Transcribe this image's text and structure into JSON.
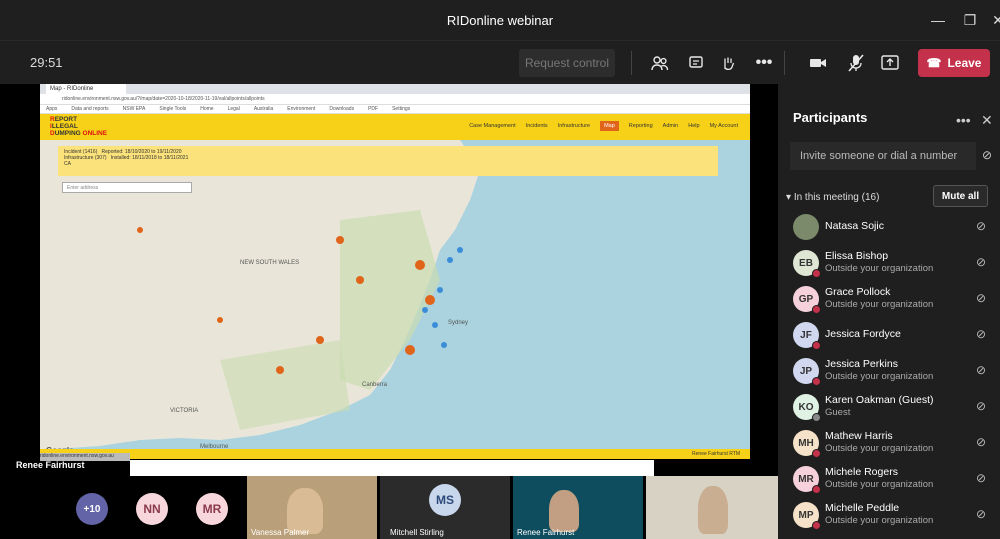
{
  "window": {
    "title": "RIDonline webinar",
    "min": "—",
    "max": "❐",
    "close": "✕"
  },
  "toolbar": {
    "timer": "29:51",
    "request_control": "Request control",
    "leave_label": "Leave",
    "icons": [
      "people-icon",
      "chat-icon",
      "raise-hand-icon",
      "more-icon",
      "camera-icon",
      "mic-off-icon",
      "share-icon"
    ]
  },
  "shared_screen": {
    "browser_tab": "Map - RIDonline",
    "url": "ridonline.environment.nsw.gov.au/?/map/date=2020-10-18/2020-11-19/val/allpoints/allpoints",
    "bookmarks": [
      "Apps",
      "Data and reports",
      "NSW EPA",
      "Single Tools",
      "Home",
      "Legal",
      "Australia",
      "Environment",
      "Downloads",
      "PDF",
      "Settings"
    ],
    "logo_lines": [
      "EPORT",
      "LLEGAL",
      "UMPING"
    ],
    "logo_letters": [
      "R",
      "I",
      "D"
    ],
    "logo_online": "ONLINE",
    "nav": [
      "Case Management",
      "Incidents",
      "Infrastructure",
      "Map",
      "Reporting",
      "Admin",
      "Help",
      "My Account"
    ],
    "active_nav": "Map",
    "filters": [
      "Incident (1416)",
      "Infrastructure (307)",
      "CA"
    ],
    "date_filters": [
      "Reported: 18/10/2020 to 19/11/2020",
      "Installed: 18/11/2018 to 18/11/2021"
    ],
    "search_placeholder": "Enter address",
    "map_labels": [
      "NEW SOUTH WALES",
      "VICTORIA",
      "Melbourne",
      "Canberra",
      "Sydney"
    ],
    "google": "Google",
    "footer_right": "Renee Fairhurst  RTM",
    "status_url": "ridonline.environment.nsw.gov.au"
  },
  "presenter_label": "Renee Fairhurst",
  "gallery": [
    {
      "type": "avatar",
      "text": "+10",
      "color": "#6264a7"
    },
    {
      "type": "avatar",
      "text": "NN",
      "color": "#f8d7dc"
    },
    {
      "type": "avatar",
      "text": "MR",
      "color": "#f8d7dc"
    },
    {
      "type": "video",
      "label": "Vanessa Palmer"
    },
    {
      "type": "avatar-tile",
      "text": "MS",
      "label": "Mitchell Stirling",
      "color": "#c9d7ec"
    },
    {
      "type": "video",
      "label": "Renee Fairhurst"
    },
    {
      "type": "video",
      "label": ""
    }
  ],
  "panel": {
    "title": "Participants",
    "invite_placeholder": "Invite someone or dial a number",
    "meeting_header": "In this meeting (16)",
    "mute_all": "Mute all",
    "participants": [
      {
        "initials": "",
        "name": "Natasa Sojic",
        "sub": "",
        "color": "#7a8a6a",
        "photo": true,
        "dot": ""
      },
      {
        "initials": "EB",
        "name": "Elissa Bishop",
        "sub": "Outside your organization",
        "color": "#dfe6d4",
        "dot": "#c4314b"
      },
      {
        "initials": "GP",
        "name": "Grace Pollock",
        "sub": "Outside your organization",
        "color": "#f6d1dc",
        "dot": "#c4314b"
      },
      {
        "initials": "JF",
        "name": "Jessica Fordyce",
        "sub": "",
        "color": "#d0d7ef",
        "dot": "#c4314b"
      },
      {
        "initials": "JP",
        "name": "Jessica Perkins",
        "sub": "Outside your organization",
        "color": "#d0d7ef",
        "dot": "#c4314b"
      },
      {
        "initials": "KO",
        "name": "Karen Oakman (Guest)",
        "sub": "Guest",
        "color": "#dff2e4",
        "dot": "#888"
      },
      {
        "initials": "MH",
        "name": "Mathew Harris",
        "sub": "Outside your organization",
        "color": "#f6e2c8",
        "dot": "#c4314b"
      },
      {
        "initials": "MR",
        "name": "Michele Rogers",
        "sub": "Outside your organization",
        "color": "#f6d1dc",
        "dot": "#c4314b"
      },
      {
        "initials": "MP",
        "name": "Michelle Peddle",
        "sub": "Outside your organization",
        "color": "#f6e2c8",
        "dot": "#c4314b"
      }
    ]
  }
}
